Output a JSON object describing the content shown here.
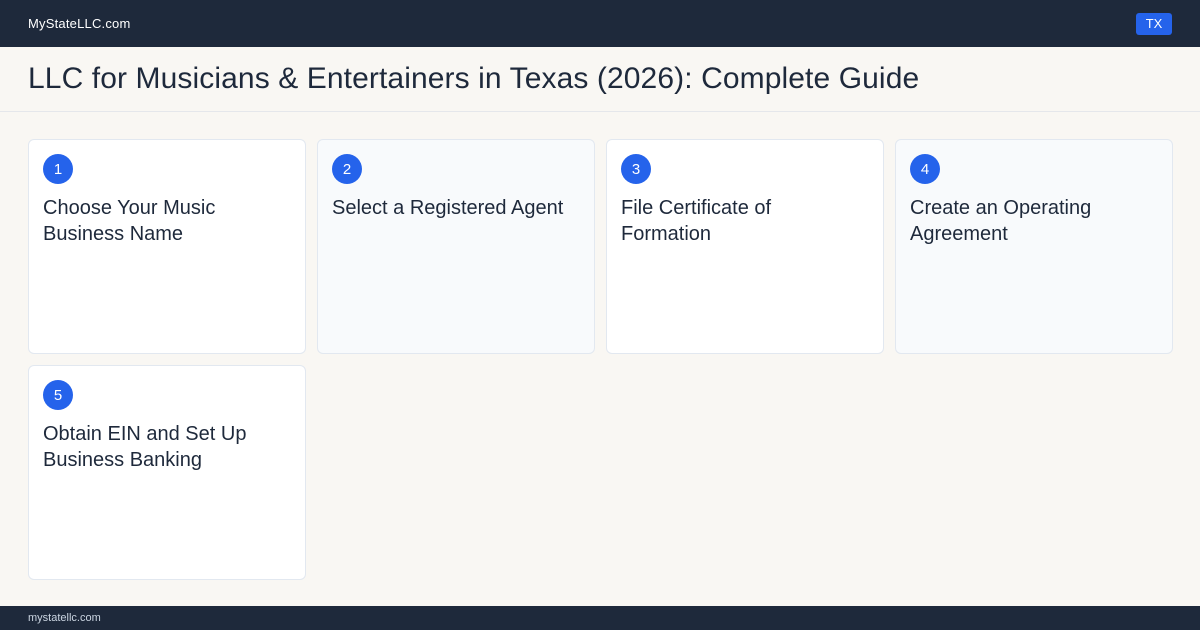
{
  "header": {
    "brand": "MyStateLLC.com",
    "state_badge": "TX"
  },
  "page": {
    "title": "LLC for Musicians & Entertainers in Texas (2026): Complete Guide"
  },
  "steps": [
    {
      "number": "1",
      "title": "Choose Your Music Business Name"
    },
    {
      "number": "2",
      "title": "Select a Registered Agent"
    },
    {
      "number": "3",
      "title": "File Certificate of Formation"
    },
    {
      "number": "4",
      "title": "Create an Operating Agreement"
    },
    {
      "number": "5",
      "title": "Obtain EIN and Set Up Business Banking"
    }
  ],
  "footer": {
    "domain": "mystatellc.com"
  },
  "colors": {
    "navy": "#1e293b",
    "accent": "#2563eb",
    "page_bg": "#f9f7f3"
  }
}
